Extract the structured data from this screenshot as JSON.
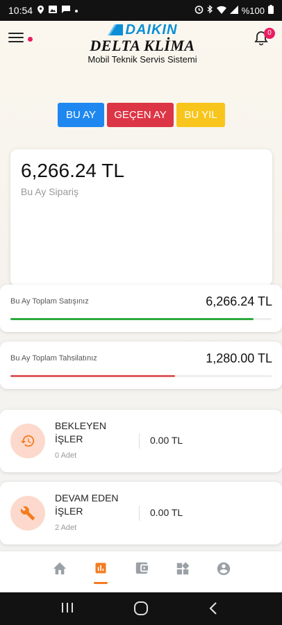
{
  "status_bar": {
    "time": "10:54",
    "battery": "%100",
    "left_icons": [
      "location-pin-icon",
      "image-icon",
      "message-icon",
      "dot-icon"
    ],
    "right_icons": [
      "alarm-icon",
      "bluetooth-icon",
      "wifi-icon",
      "signal-icon",
      "battery-icon"
    ]
  },
  "header": {
    "brand": "DAIKIN",
    "company": "DELTA KLİMA",
    "subtitle": "Mobil Teknik Servis Sistemi",
    "notification_count": "0"
  },
  "period_buttons": [
    {
      "label": "BU AY",
      "color": "#1e88f0"
    },
    {
      "label": "GEÇEN AY",
      "color": "#dc3545"
    },
    {
      "label": "BU YIL",
      "color": "#f8c51c"
    }
  ],
  "summary": {
    "amount": "6,266.24 TL",
    "label": "Bu Ay Sipariş"
  },
  "stats": [
    {
      "label": "Bu Ay Toplam Satışınız",
      "value": "6,266.24 TL",
      "progress": 0.93,
      "color": "#2eaa3f"
    },
    {
      "label": "Bu Ay Toplam Tahsilatınız",
      "value": "1,280.00 TL",
      "progress": 0.63,
      "color": "#dc5b5b"
    }
  ],
  "jobs": [
    {
      "title": "BEKLEYEN İŞLER",
      "count": "0 Adet",
      "value": "0.00 TL",
      "icon": "history-icon"
    },
    {
      "title": "DEVAM EDEN İŞLER",
      "count": "2 Adet",
      "value": "0.00 TL",
      "icon": "wrench-icon"
    }
  ],
  "bottom_nav": [
    {
      "name": "home-icon",
      "active": false
    },
    {
      "name": "dashboard-icon",
      "active": true
    },
    {
      "name": "wallet-icon",
      "active": false
    },
    {
      "name": "widgets-icon",
      "active": false
    },
    {
      "name": "account-icon",
      "active": false
    }
  ],
  "accent_color": "#f47c20"
}
